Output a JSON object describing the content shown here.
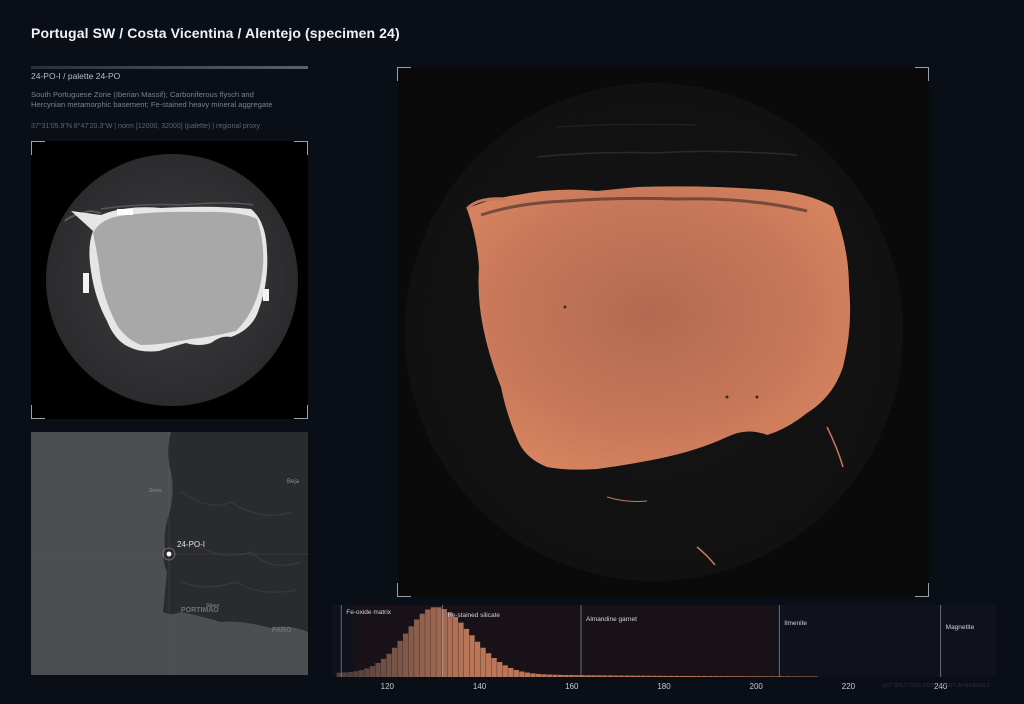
{
  "header": {
    "title": "Portugal SW / Costa Vicentina / Alentejo (specimen 24)"
  },
  "sample": {
    "id_line": "24-PO-I  /  palette 24-PO",
    "description": "South Portuguese Zone (Iberian Massif); Carboniferous flysch and Hercynian metamorphic basement; Fe-stained heavy mineral aggregate",
    "meta_line": "37°31'05.9\"N 8°47'20.3\"W  |  norm [12000, 32000] (palette)  |  regional proxy"
  },
  "map": {
    "marker_label": "24-PO-I",
    "places": [
      "Sines",
      "Beja",
      "Silves",
      "PORTIMÃO",
      "FARO"
    ]
  },
  "histogram": {
    "phases": [
      {
        "label": "Fe-oxide matrix",
        "x": 110
      },
      {
        "label": "Fe-stained silicate",
        "x": 132
      },
      {
        "label": "Almandine garnet",
        "x": 162
      },
      {
        "label": "Ilmenite",
        "x": 205
      },
      {
        "label": "Magnetite",
        "x": 240
      }
    ],
    "x_ticks": [
      120,
      140,
      160,
      180,
      200,
      220,
      240
    ],
    "xlim": [
      108,
      252
    ],
    "peak": 130,
    "credit": "µCT SPECTROS 2025  /  QUANTUM MINERALS"
  },
  "colors": {
    "background": "#0a0e17",
    "accent": "#d9825f",
    "map_land": "#2a2b2e",
    "map_sea": "#4d4e51"
  }
}
